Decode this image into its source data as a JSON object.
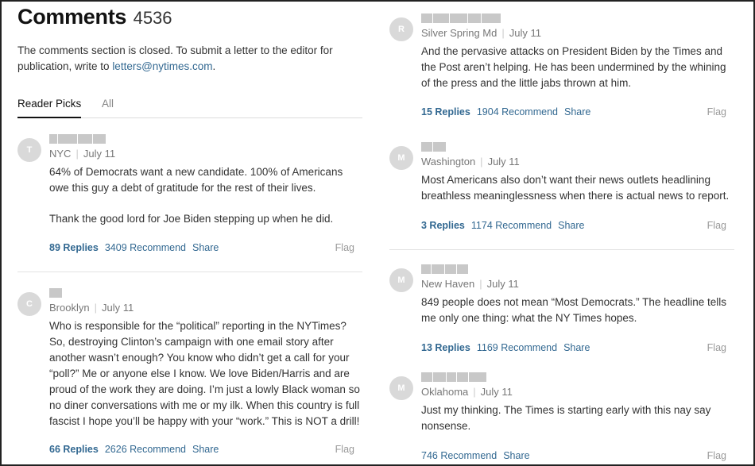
{
  "header": {
    "title": "Comments",
    "count": "4536"
  },
  "notice": {
    "text": "The comments section is closed. To submit a letter to the editor for publication, write to ",
    "email": "letters@nytimes.com",
    "period": "."
  },
  "tabs": [
    {
      "label": "Reader Picks"
    },
    {
      "label": "All"
    }
  ],
  "comments": [
    {
      "initial": "T",
      "location": "NYC",
      "date": "July 11",
      "paragraphs": [
        "64% of Democrats want a new candidate. 100% of Americans owe this guy a debt of gratitude for the rest of their lives.",
        "Thank the good lord for Joe Biden stepping up when he did."
      ],
      "replies": "89 Replies",
      "recommend": "3409 Recommend",
      "share": "Share",
      "flag": "Flag"
    },
    {
      "initial": "C",
      "location": "Brooklyn",
      "date": "July 11",
      "paragraphs": [
        "Who is responsible for the “political” reporting in the NYTimes? So, destroying Clinton’s campaign with one email story after another wasn’t enough? You know who didn’t get a call for your “poll?” Me or anyone else I know. We love Biden/Harris and are proud of the work they are doing. I’m just a lowly Black woman so no diner conversations with me or my ilk. When this country is full fascist I hope you’ll be happy with your “work.” This is NOT a drill!"
      ],
      "replies": "66 Replies",
      "recommend": "2626 Recommend",
      "share": "Share",
      "flag": "Flag"
    },
    {
      "initial": "R",
      "location": "Silver Spring Md",
      "date": "July 11",
      "paragraphs": [
        "And the pervasive attacks on President Biden by the Times and the Post aren’t helping. He has been undermined by the whining of the press and the little jabs thrown at him."
      ],
      "replies": "15 Replies",
      "recommend": "1904 Recommend",
      "share": "Share",
      "flag": "Flag"
    },
    {
      "initial": "M",
      "location": "Washington",
      "date": "July 11",
      "paragraphs": [
        "Most Americans also don’t want their news outlets headlining breathless meaninglessness when there is actual news to report."
      ],
      "replies": "3 Replies",
      "recommend": "1174 Recommend",
      "share": "Share",
      "flag": "Flag"
    },
    {
      "initial": "M",
      "location": "New Haven",
      "date": "July 11",
      "paragraphs": [
        "849 people does not mean “Most Democrats.” The headline tells me only one thing: what the NY Times hopes."
      ],
      "replies": "13 Replies",
      "recommend": "1169 Recommend",
      "share": "Share",
      "flag": "Flag"
    },
    {
      "initial": "M",
      "location": "Oklahoma",
      "date": "July 11",
      "paragraphs": [
        "Just my thinking. The Times is starting early with this nay say nonsense."
      ],
      "recommend": "746 Recommend",
      "share": "Share",
      "flag": "Flag"
    }
  ]
}
